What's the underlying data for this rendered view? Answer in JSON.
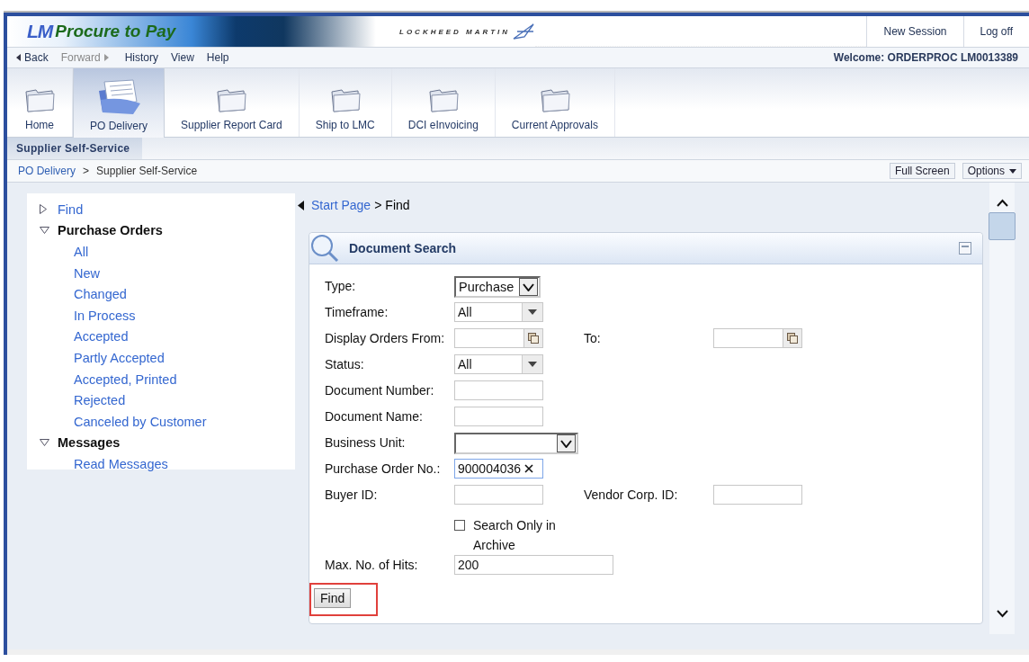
{
  "header": {
    "logo_prefix": "LM",
    "logo_text": "Procure to Pay",
    "brand": "LOCKHEED MARTIN",
    "links": [
      "New Session",
      "Log off"
    ]
  },
  "menu": {
    "items": [
      {
        "label": "Back",
        "kind": "back",
        "disabled": false
      },
      {
        "label": "Forward",
        "kind": "forward",
        "disabled": true
      },
      {
        "label": "History",
        "kind": "plain",
        "disabled": false
      },
      {
        "label": "View",
        "kind": "plain",
        "disabled": false
      },
      {
        "label": "Help",
        "kind": "plain",
        "disabled": false
      }
    ],
    "welcome": "Welcome: ORDERPROC LM0013389"
  },
  "tabs": [
    {
      "label": "Home",
      "selected": false
    },
    {
      "label": "PO Delivery",
      "selected": true
    },
    {
      "label": "Supplier Report Card",
      "selected": false
    },
    {
      "label": "Ship to LMC",
      "selected": false
    },
    {
      "label": "DCI eInvoicing",
      "selected": false
    },
    {
      "label": "Current Approvals",
      "selected": false
    }
  ],
  "subtabs": [
    {
      "label": "Supplier Self-Service",
      "selected": true
    }
  ],
  "breadcrumb": {
    "separator": ">",
    "items": [
      {
        "label": "PO Delivery",
        "kind": "link"
      },
      {
        "label": "Supplier Self-Service",
        "kind": "text"
      }
    ]
  },
  "page_buttons": [
    {
      "label": "Full Screen",
      "kind": "plain"
    },
    {
      "label": "Options",
      "kind": "menu"
    }
  ],
  "tree": [
    {
      "label": "Find",
      "expanded": false
    },
    {
      "label": "Purchase Orders",
      "expanded": true,
      "children": [
        {
          "label": "All"
        },
        {
          "label": "New"
        },
        {
          "label": "Changed"
        },
        {
          "label": "In Process"
        },
        {
          "label": "Accepted"
        },
        {
          "label": "Partly Accepted"
        },
        {
          "label": "Accepted, Printed"
        },
        {
          "label": "Rejected"
        },
        {
          "label": "Canceled by Customer"
        }
      ]
    },
    {
      "label": "Messages",
      "expanded": true,
      "children": [
        {
          "label": "Read Messages"
        }
      ]
    }
  ],
  "content_path": {
    "separator": ">",
    "items": [
      {
        "label": "Start Page",
        "kind": "link"
      },
      {
        "label": "Find",
        "kind": "text"
      }
    ]
  },
  "panel": {
    "title": "Document Search",
    "rows": [
      {
        "cells": [
          {
            "kind": "listbox",
            "label": "Type:",
            "value": "Purchase"
          }
        ]
      },
      {
        "cells": [
          {
            "kind": "dropdown",
            "label": "Timeframe:",
            "value": "All"
          }
        ]
      },
      {
        "cells": [
          {
            "kind": "date",
            "label": "Display Orders From:"
          },
          {
            "kind": "date",
            "label": "To:"
          }
        ]
      },
      {
        "cells": [
          {
            "kind": "dropdown",
            "label": "Status:",
            "value": "All"
          }
        ]
      },
      {
        "cells": [
          {
            "kind": "text",
            "label": "Document Number:"
          }
        ]
      },
      {
        "cells": [
          {
            "kind": "text",
            "label": "Document Name:"
          }
        ]
      },
      {
        "cells": [
          {
            "kind": "listbox",
            "label": "Business Unit:"
          }
        ]
      },
      {
        "cells": [
          {
            "kind": "text",
            "label": "Purchase Order No.:",
            "value": "900004036",
            "focused": true
          }
        ]
      },
      {
        "cells": [
          {
            "kind": "text",
            "label": "Buyer ID:"
          },
          {
            "kind": "text",
            "label": "Vendor Corp. ID:"
          }
        ]
      },
      {
        "cells": [
          {
            "kind": "checkbox",
            "label": "Search Only in Archive",
            "checked": false
          }
        ]
      },
      {
        "cells": [
          {
            "kind": "wide",
            "label": "Max. No. of Hits:",
            "value": "200"
          }
        ]
      }
    ],
    "find_button": {
      "label": "Find",
      "highlighted": true
    }
  }
}
